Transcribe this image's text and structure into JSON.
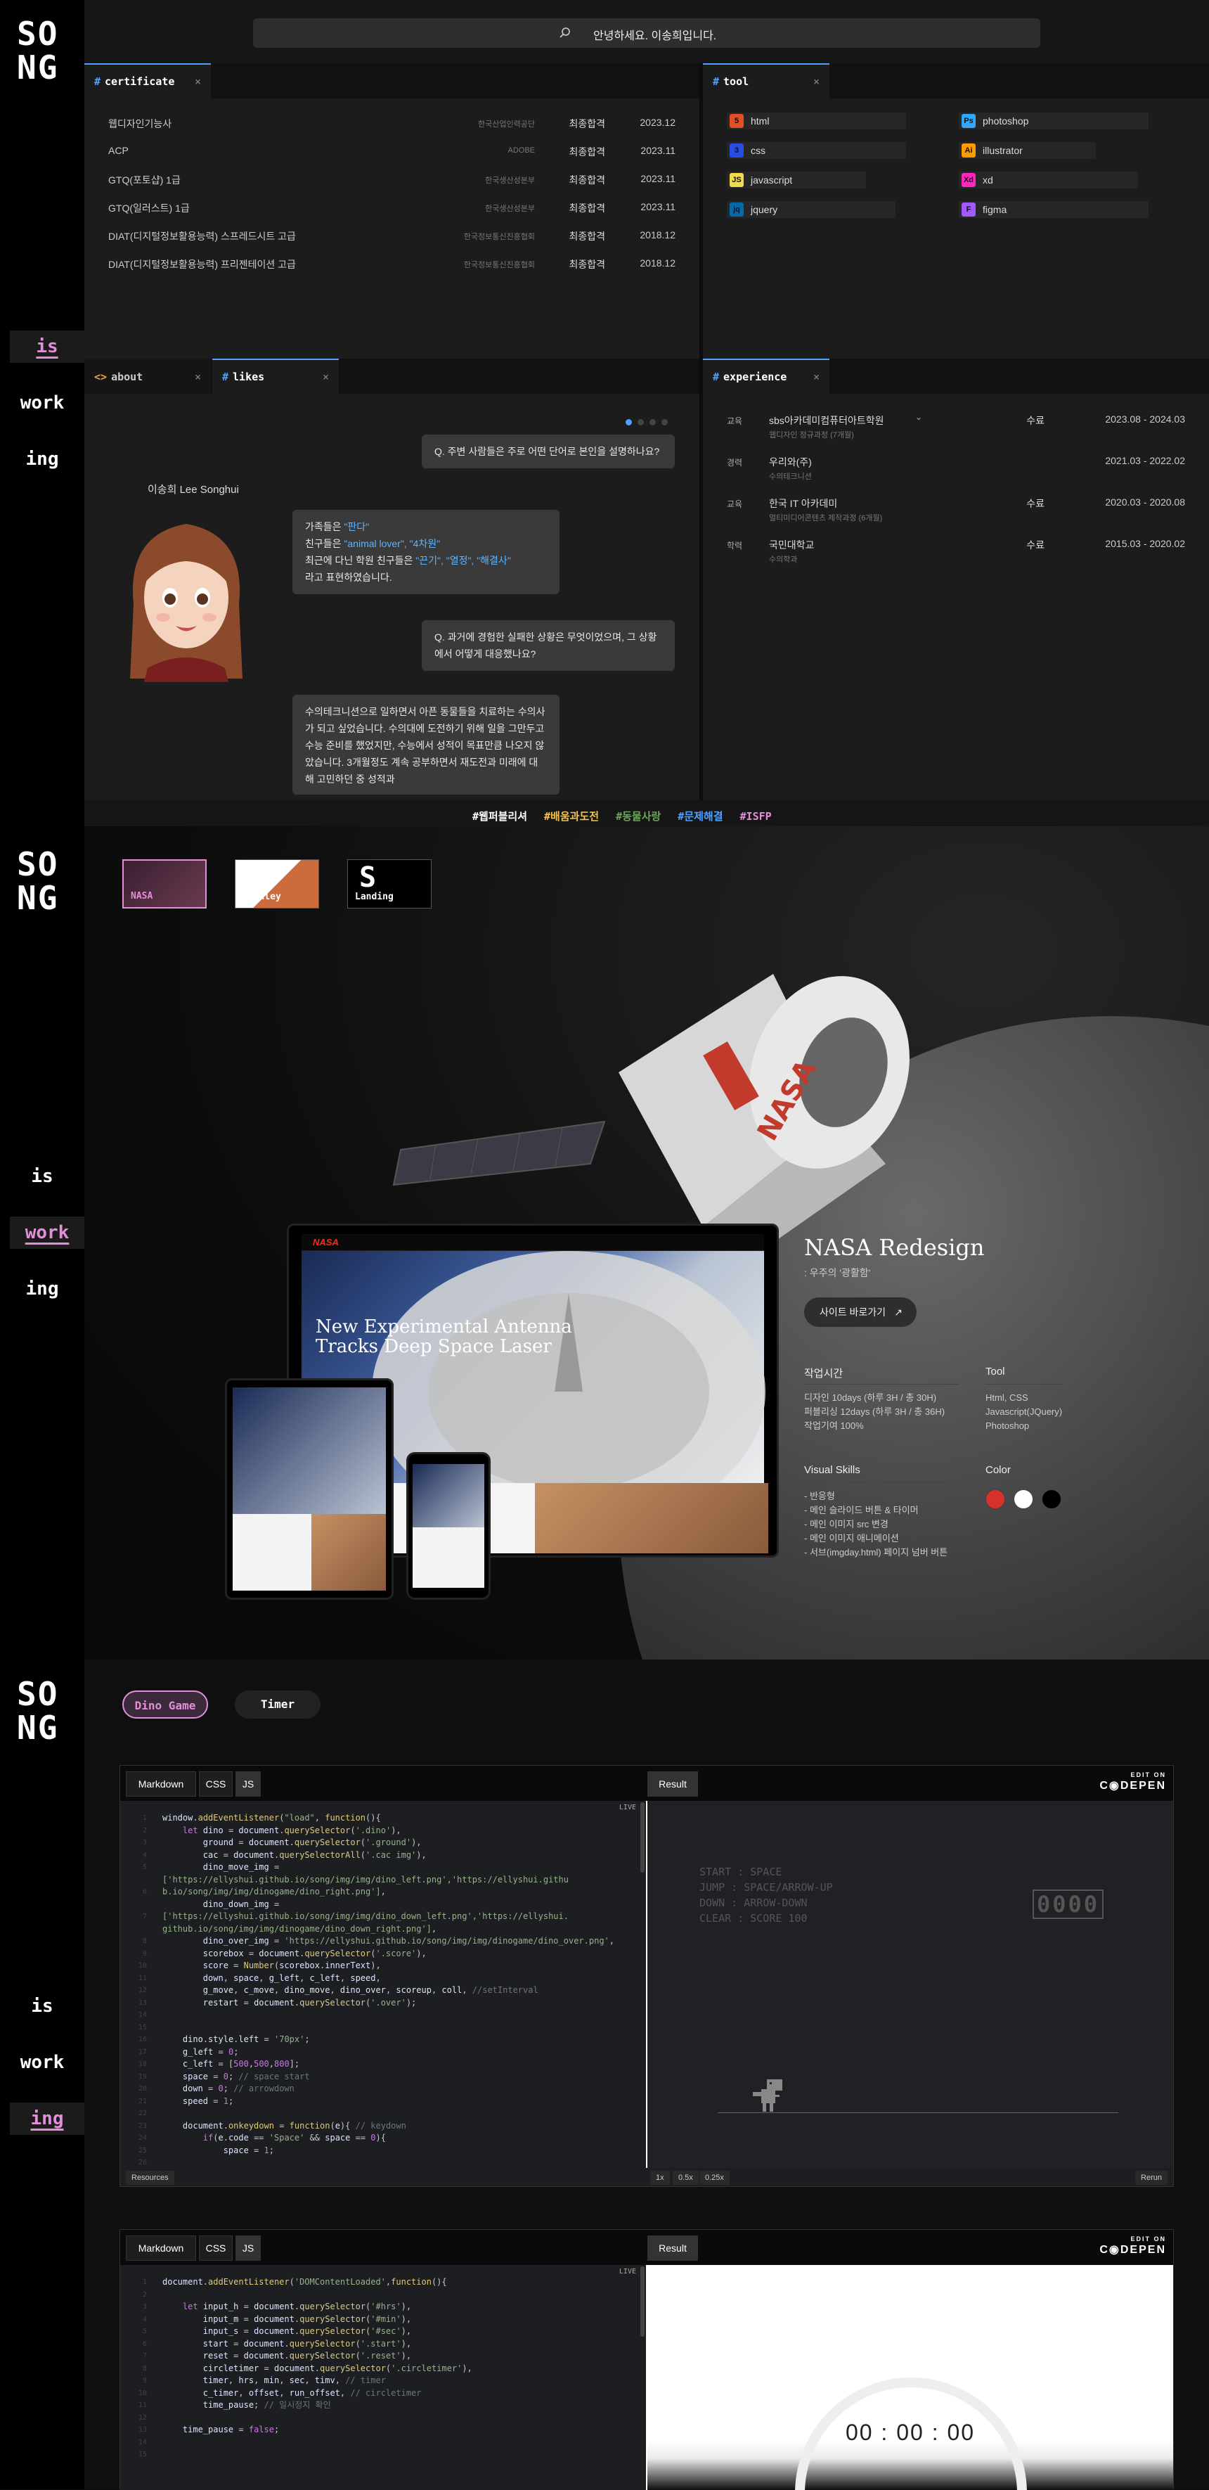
{
  "brand": {
    "logo_line1": "SO",
    "logo_line2": "NG"
  },
  "nav_words": [
    "is",
    "work",
    "ing"
  ],
  "search": {
    "placeholder": "안녕하세요. 이송희입니다.",
    "icon": "search-icon"
  },
  "certificate": {
    "tab_label": "certificate",
    "rows": [
      {
        "name": "웹디자인기능사",
        "org": "한국산업인력공단",
        "result": "최종합격",
        "date": "2023.12"
      },
      {
        "name": "ACP",
        "org": "ADOBE",
        "result": "최종합격",
        "date": "2023.11"
      },
      {
        "name": "GTQ(포토샵) 1급",
        "org": "한국생산성본부",
        "result": "최종합격",
        "date": "2023.11"
      },
      {
        "name": "GTQ(일러스트) 1급",
        "org": "한국생산성본부",
        "result": "최종합격",
        "date": "2023.11"
      },
      {
        "name": "DIAT(디지털정보활용능력) 스프레드시트 고급",
        "org": "한국정보통신진흥협회",
        "result": "최종합격",
        "date": "2018.12"
      },
      {
        "name": "DIAT(디지털정보활용능력) 프리젠테이션 고급",
        "org": "한국정보통신진흥협회",
        "result": "최종합격",
        "date": "2018.12"
      }
    ]
  },
  "tool": {
    "tab_label": "tool",
    "items": [
      {
        "label": "html",
        "icon": "html5-icon",
        "badge": "5",
        "color": "#e44d26",
        "fill": 0.85
      },
      {
        "label": "photoshop",
        "icon": "photoshop-icon",
        "badge": "Ps",
        "color": "#31a8ff",
        "fill": 0.9
      },
      {
        "label": "css",
        "icon": "css3-icon",
        "badge": "3",
        "color": "#264de4",
        "fill": 0.85
      },
      {
        "label": "illustrator",
        "icon": "illustrator-icon",
        "badge": "Ai",
        "color": "#ff9a00",
        "fill": 0.65
      },
      {
        "label": "javascript",
        "icon": "javascript-icon",
        "badge": "JS",
        "color": "#f0db4f",
        "fill": 0.66
      },
      {
        "label": "xd",
        "icon": "xd-icon",
        "badge": "Xd",
        "color": "#ff26be",
        "fill": 0.85
      },
      {
        "label": "jquery",
        "icon": "jquery-icon",
        "badge": "jq",
        "color": "#0769ad",
        "fill": 0.8
      },
      {
        "label": "figma",
        "icon": "figma-icon",
        "badge": "F",
        "color": "#a259ff",
        "fill": 0.9
      }
    ]
  },
  "about": {
    "tab_about": "about",
    "tab_likes": "likes",
    "name": "이송희 Lee Songhui",
    "q1": "Q. 주변 사람들은 주로 어떤 단어로 본인을 설명하나요?",
    "a1": {
      "l1_pre": "가족들은 ",
      "l1_hl": "\"판다\"",
      "l2_pre": "친구들은 ",
      "l2_hl": "\"animal lover\", \"4차원\"",
      "l3_pre": "최근에 다닌 학원 친구들은 ",
      "l3_hl": "\"끈기\", \"열정\", \"해결사\"",
      "l4": "라고 표현하였습니다."
    },
    "q2": "Q. 과거에 경험한 실패한 상황은 무엇이었으며, 그 상황에서 어떻게 대응했나요?",
    "a2": "수의테크니션으로 일하면서 아픈 동물들을 치료하는 수의사가 되고 싶었습니다. 수의대에 도전하기 위해 일을 그만두고 수능 준비를 했었지만, 수능에서 성적이 목표만큼 나오지 않았습니다. 3개월정도 계속 공부하면서 재도전과 미래에 대해 고민하던 중 성적과"
  },
  "experience": {
    "tab_label": "experience",
    "rows": [
      {
        "category": "교육",
        "school": "sbs아카데미컴퓨터아트학원",
        "sub": "웹디자인 정규과정 (7개월)",
        "status": "수료",
        "period": "2023.08 - 2024.03"
      },
      {
        "category": "경력",
        "school": "우리와(주)",
        "sub": "수의테크니션",
        "status": "",
        "period": "2021.03 - 2022.02"
      },
      {
        "category": "교육",
        "school": "한국 IT 아카데미",
        "sub": "멀티미디어콘텐츠 제작과정 (6개월)",
        "status": "수료",
        "period": "2020.03 - 2020.08"
      },
      {
        "category": "학력",
        "school": "국민대학교",
        "sub": "수의학과",
        "status": "수료",
        "period": "2015.03 - 2020.02"
      }
    ]
  },
  "hashtags": [
    {
      "text": "#웹퍼블리셔",
      "color": "#ffffff"
    },
    {
      "text": "#배움과도전",
      "color": "#f3c34b"
    },
    {
      "text": "#동물사랑",
      "color": "#6ca55e"
    },
    {
      "text": "#문제해결",
      "color": "#4ea1ff"
    },
    {
      "text": "#ISFP",
      "color": "#e38ed8"
    }
  ],
  "work": {
    "thumbs": [
      {
        "label": "NASA"
      },
      {
        "label": "Stanley"
      },
      {
        "label": "Landing"
      }
    ],
    "mock_title_l1": "New Experimental Antenna",
    "mock_title_l2": "Tracks Deep Space Laser",
    "mock_logo": "NASA",
    "project_title": "NASA Redesign",
    "project_subtitle": ": 우주의 '광활함'",
    "site_button": "사이트 바로가기",
    "time_heading": "작업시간",
    "time_lines": [
      "디자인 10days (하루 3H / 총 30H)",
      "퍼블리싱 12days (하루 3H / 총 36H)",
      "작업기여 100%"
    ],
    "tool_heading": "Tool",
    "tool_lines": [
      "Html, CSS",
      "Javascript(JQuery)",
      "Photoshop"
    ],
    "skills_heading": "Visual Skills",
    "skills_lines": [
      "- 반응형",
      "- 메인 슬라이드 버튼 & 타이머",
      "- 메인 이미지 src 변경",
      "- 메인 이미지 애니메이션",
      "- 서브(imgday.html) 페이지 넘버 버튼"
    ],
    "color_heading": "Color",
    "colors": [
      "#d8302b",
      "#ffffff",
      "#000000"
    ]
  },
  "code_section": {
    "chip_game": "Dino Game",
    "chip_timer": "Timer",
    "tabs": [
      "Markdown",
      "CSS",
      "JS"
    ],
    "result_tab": "Result",
    "edit_on": "EDIT ON",
    "codepen": "C◉DEPEN",
    "live": "LIVE",
    "resources": "Resources",
    "zoom": [
      "1x",
      "0.5x",
      "0.25x"
    ],
    "rerun": "Rerun",
    "game_instructions": [
      "START : SPACE",
      "JUMP : SPACE/ARROW-UP",
      "DOWN : ARROW-DOWN",
      "CLEAR : SCORE 100"
    ],
    "score": "0000",
    "timer_display": "00 : 00 : 00"
  }
}
